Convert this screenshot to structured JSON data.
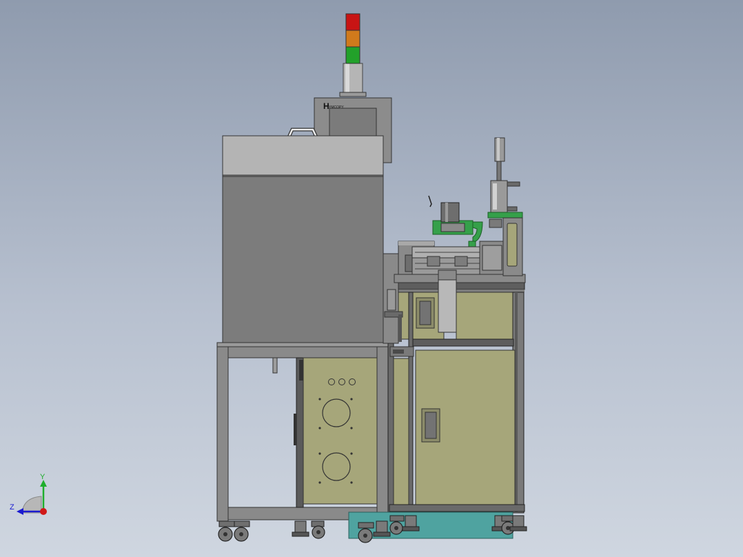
{
  "viewport": {
    "background_top": "#8f9bae",
    "background_bottom": "#cfd6e0"
  },
  "machine": {
    "brand_mark": "H",
    "brand_text": "YMCOPY",
    "tower_light_colors": [
      "#c81414",
      "#d07a1c",
      "#22a12a"
    ],
    "frame_color": "#8a8a8a",
    "panel_color": "#a6a67a",
    "base_color": "#4fa3a0",
    "accent_green": "#35a04a"
  },
  "triad": {
    "y_label": "Y",
    "z_label": "Z",
    "y_axis_color": "#1fae2c",
    "z_axis_color": "#1a1ad0",
    "origin_color": "#d01818"
  }
}
